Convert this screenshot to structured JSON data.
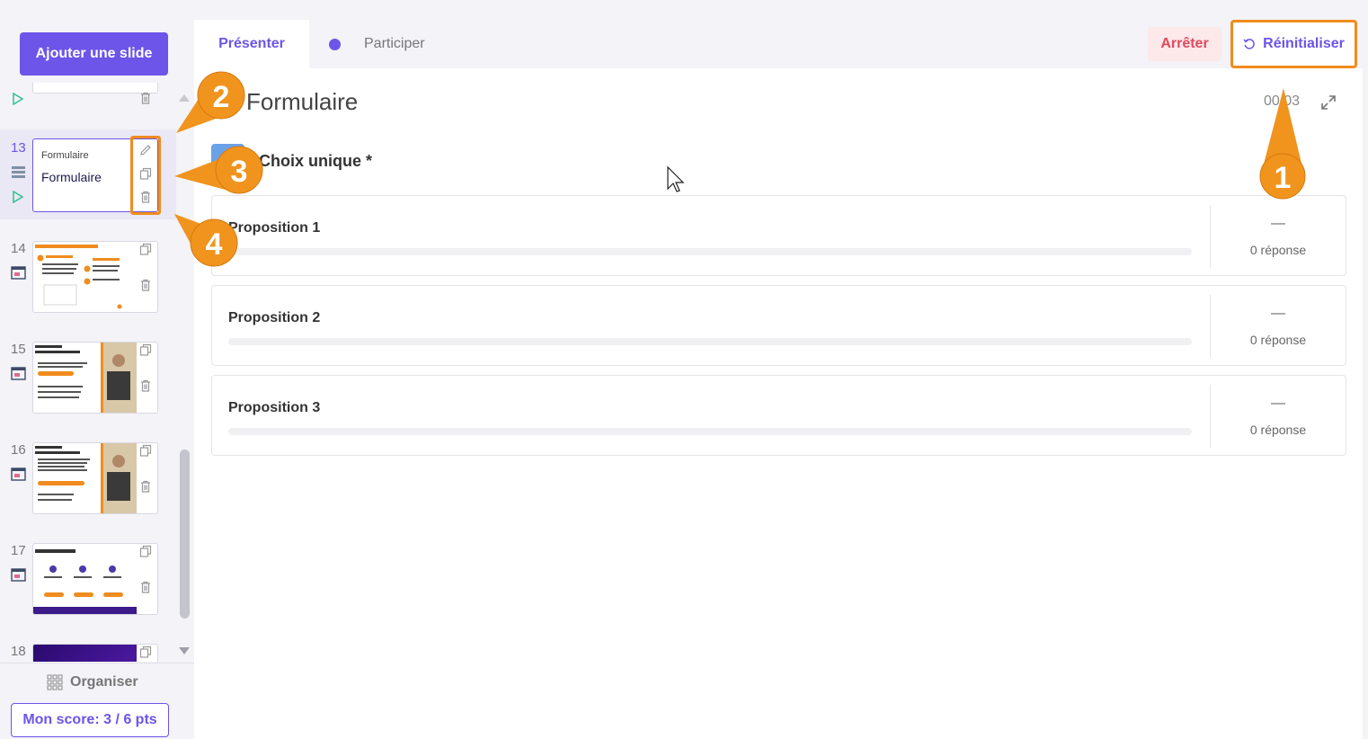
{
  "sidebar": {
    "add_slide_label": "Ajouter une slide",
    "organise_label": "Organiser",
    "score_label": "Mon score: 3 / 6 pts",
    "slides": [
      {
        "number": "",
        "type": "play"
      },
      {
        "number": "13",
        "type": "form",
        "small_title": "Formulaire",
        "big_title": "Formulaire",
        "active": true
      },
      {
        "number": "14",
        "type": "presentation"
      },
      {
        "number": "15",
        "type": "presentation"
      },
      {
        "number": "16",
        "type": "presentation"
      },
      {
        "number": "17",
        "type": "presentation"
      },
      {
        "number": "18",
        "type": "presentation"
      }
    ]
  },
  "tabs": {
    "present_label": "Présenter",
    "participate_label": "Participer"
  },
  "actions": {
    "stop_label": "Arrêter",
    "reset_label": "Réinitialiser"
  },
  "content": {
    "title": "Formulaire",
    "timer": "00:03",
    "question_label": "Choix unique *",
    "propositions": [
      {
        "label": "Proposition 1",
        "value": "—",
        "count": "0 réponse"
      },
      {
        "label": "Proposition 2",
        "value": "—",
        "count": "0 réponse"
      },
      {
        "label": "Proposition 3",
        "value": "—",
        "count": "0 réponse"
      }
    ]
  },
  "callouts": [
    "1",
    "2",
    "3",
    "4"
  ],
  "colors": {
    "accent": "#6c55e8",
    "highlight": "#f08c1e",
    "danger": "#e04a5f",
    "question_badge": "#6aa2e8"
  }
}
